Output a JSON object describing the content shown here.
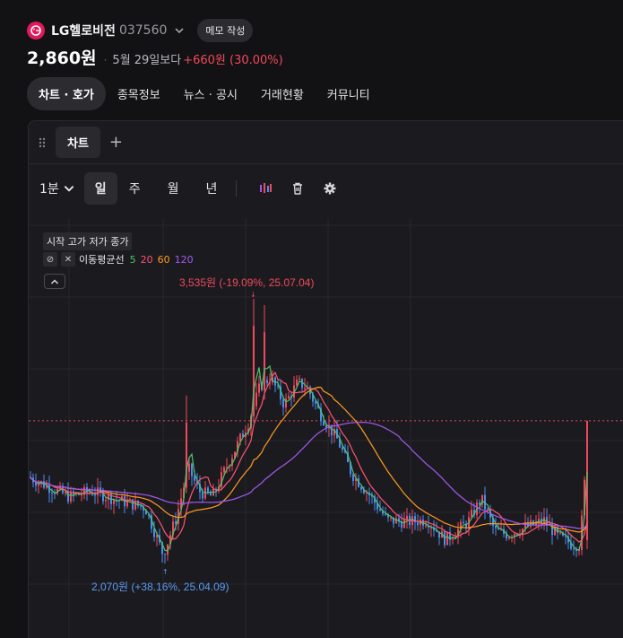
{
  "header": {
    "company": "LG헬로비전",
    "code": "037560",
    "memo_label": "메모 작성",
    "price": "2,860원",
    "since": "5월 29일보다",
    "change": "+660원 (30.00%)"
  },
  "tabs": [
    {
      "label": "차트 · 호가"
    },
    {
      "label": "종목정보"
    },
    {
      "label": "뉴스 · 공시"
    },
    {
      "label": "거래현황"
    },
    {
      "label": "커뮤니티"
    }
  ],
  "panel": {
    "tab_label": "차트",
    "add_label": "+"
  },
  "toolbar": {
    "interval": "1분",
    "periods": [
      "일",
      "주",
      "월",
      "년"
    ]
  },
  "legend": {
    "ohlc": "시작 고가 저가 종가",
    "ma_label": "이동평균선",
    "ma_periods": [
      "5",
      "20",
      "60",
      "120"
    ]
  },
  "chart_data": {
    "type": "candlestick",
    "current_price": 2860,
    "annotations": [
      {
        "text": "3,535원 (-19.09%, 25.07.04)",
        "value": 3535,
        "date": "25.07.04",
        "kind": "high"
      },
      {
        "text": "2,070원 (+38.16%, 25.04.09)",
        "value": 2070,
        "date": "25.04.09",
        "kind": "low"
      }
    ],
    "moving_averages": [
      "5",
      "20",
      "60",
      "120"
    ],
    "colors": {
      "up": "#f0495c",
      "down": "#4a8cf0",
      "ma5": "#4cc26b",
      "ma20": "#ff5470",
      "ma60": "#ff9a1f",
      "ma120": "#a458f0"
    }
  }
}
